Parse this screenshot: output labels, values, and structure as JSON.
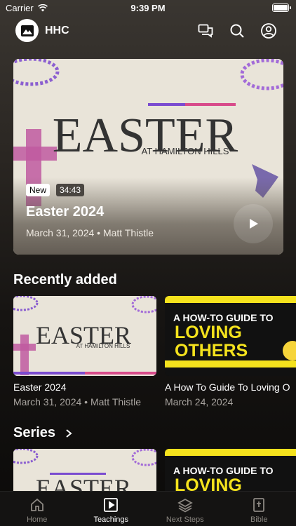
{
  "status_bar": {
    "carrier": "Carrier",
    "time": "9:39 PM"
  },
  "header": {
    "brand": "HHC"
  },
  "hero": {
    "badge_new": "New",
    "duration": "34:43",
    "title": "Easter 2024",
    "meta": "March 31, 2024 • Matt Thistle",
    "art": {
      "title": "EASTER",
      "subtitle": "AT HAMILTON HILLS"
    }
  },
  "recently_added": {
    "title": "Recently added",
    "items": [
      {
        "title": "Easter 2024",
        "meta": "March 31, 2024 • Matt Thistle"
      },
      {
        "title": "A How To Guide To Loving O",
        "meta": "March 24, 2024"
      }
    ]
  },
  "series": {
    "title": "Series"
  },
  "art_loving": {
    "line1": "A HOW-TO GUIDE TO",
    "line2": "LOVING",
    "line3": "OTHERS"
  },
  "tabs": [
    {
      "label": "Home",
      "icon": "home-icon"
    },
    {
      "label": "Teachings",
      "icon": "play-square-icon"
    },
    {
      "label": "Next Steps",
      "icon": "layers-icon"
    },
    {
      "label": "Bible",
      "icon": "bible-icon"
    }
  ],
  "colors": {
    "accent_yellow": "#f4e21d",
    "cream": "#e9e4d9",
    "purple": "#8b5fd0"
  }
}
